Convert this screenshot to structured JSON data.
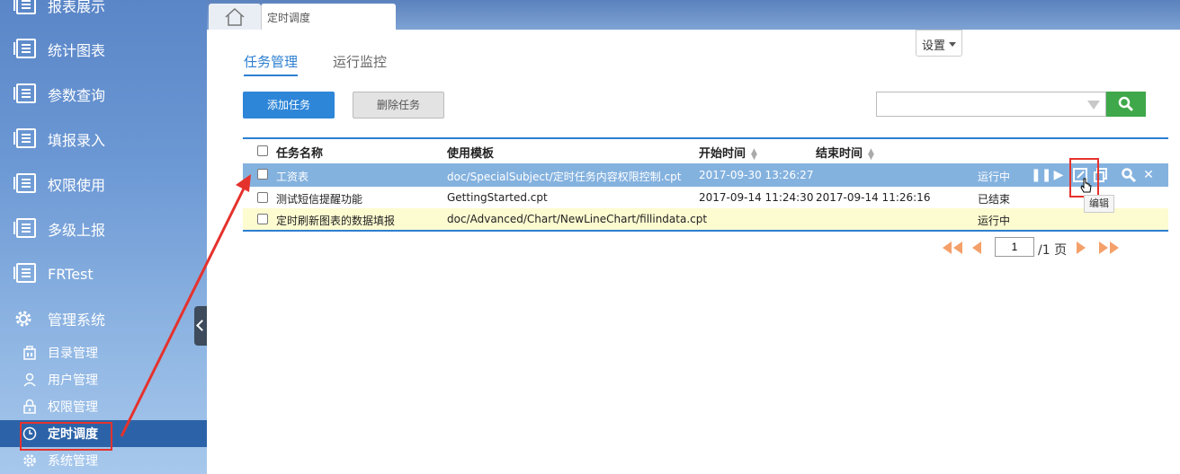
{
  "sidebar": {
    "items": [
      {
        "label": "报表展示",
        "icon": "document-list-icon"
      },
      {
        "label": "统计图表",
        "icon": "document-list-icon"
      },
      {
        "label": "参数查询",
        "icon": "document-list-icon"
      },
      {
        "label": "填报录入",
        "icon": "document-list-icon"
      },
      {
        "label": "权限使用",
        "icon": "document-list-icon"
      },
      {
        "label": "多级上报",
        "icon": "document-list-icon"
      },
      {
        "label": "FRTest",
        "icon": "document-list-icon"
      },
      {
        "label": "管理系统",
        "icon": "gear-icon"
      }
    ],
    "sub_items": [
      {
        "label": "目录管理",
        "icon": "building-icon"
      },
      {
        "label": "用户管理",
        "icon": "user-icon"
      },
      {
        "label": "权限管理",
        "icon": "lock-icon"
      },
      {
        "label": "定时调度",
        "icon": "clock-icon",
        "active": true
      },
      {
        "label": "系统管理",
        "icon": "gear-icon"
      }
    ]
  },
  "topbar": {
    "home_icon": "home-icon",
    "active_tab": "定时调度"
  },
  "main": {
    "tabs": [
      {
        "label": "任务管理",
        "active": true
      },
      {
        "label": "运行监控",
        "active": false
      }
    ],
    "settings_label": "设置",
    "add_task_label": "添加任务",
    "delete_task_label": "删除任务",
    "search": {
      "value": "",
      "placeholder": ""
    }
  },
  "table": {
    "headers": {
      "name": "任务名称",
      "template": "使用模板",
      "start": "开始时间",
      "end": "结束时间"
    },
    "rows": [
      {
        "name": "工资表",
        "template": "doc/SpecialSubject/定时任务内容权限控制.cpt",
        "start": "2017-09-30 13:26:27",
        "end": "",
        "status": "运行中",
        "selected": true
      },
      {
        "name": "测试短信提醒功能",
        "template": "GettingStarted.cpt",
        "start": "2017-09-14 11:24:30",
        "end": "2017-09-14 11:26:16",
        "status": "已结束"
      },
      {
        "name": "定时刷新图表的数据填报",
        "template": "doc/Advanced/Chart/NewLineChart/fillindata.cpt",
        "start": "",
        "end": "",
        "status": "运行中"
      }
    ],
    "tooltip": "编辑"
  },
  "pagination": {
    "current_page": "1",
    "total_label": "/1 页"
  },
  "colors": {
    "accent": "#2d7fd1",
    "selected_row": "#84b2df",
    "highlight_row": "#fdfbd0",
    "annotation_red": "#e5322d",
    "search_green": "#3fa84a"
  }
}
